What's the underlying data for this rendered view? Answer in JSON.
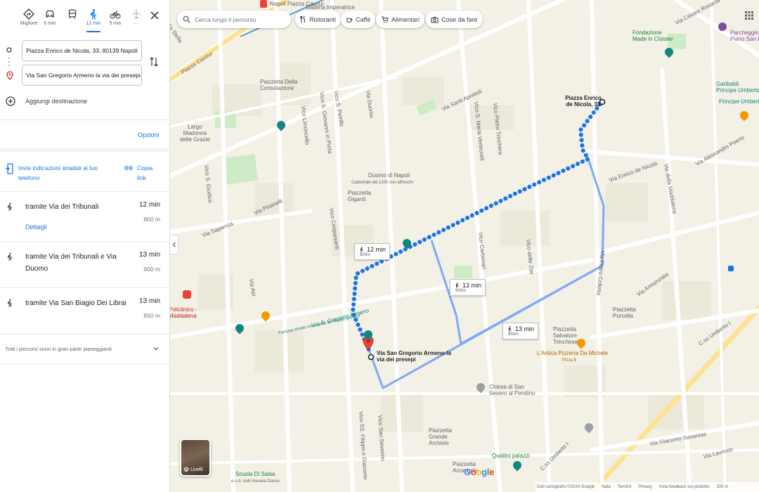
{
  "modes": [
    {
      "label": "Migliore",
      "icon": "best-route-icon"
    },
    {
      "label": "6 min",
      "icon": "car-icon"
    },
    {
      "label": "",
      "icon": "transit-icon"
    },
    {
      "label": "12 min",
      "icon": "walk-icon",
      "active": true
    },
    {
      "label": "5 min",
      "icon": "bike-icon"
    },
    {
      "label": "—",
      "icon": "flight-icon"
    }
  ],
  "origin": "Piazza Enrico de Nicola, 33, 80139 Napoli",
  "destination": "Via San Gregorio Armeno la via dei presepi",
  "add_destination": "Aggiungi destinazione",
  "options": "Opzioni",
  "send_to_phone": "Invia indicazioni stradali al tuo telefono",
  "copy_link": "Copia link",
  "routes": [
    {
      "name": "tramite Via dei Tribunali",
      "time": "12 min",
      "distance": "800 m",
      "details": "Dettagli"
    },
    {
      "name": "tramite Via dei Tribunali e Via Duomo",
      "time": "13 min",
      "distance": "900 m"
    },
    {
      "name": "tramite Via San Biagio Dei Librai",
      "time": "13 min",
      "distance": "850 m"
    }
  ],
  "flat_note": "Tutti i percorsi sono in gran parte pianeggianti",
  "search_placeholder": "Cerca lungo il percorso",
  "chips": [
    "Ristoranti",
    "Caffè",
    "Alimentari",
    "Cose da fare"
  ],
  "route_tags": [
    {
      "time": "12 min",
      "dist": "800m"
    },
    {
      "time": "13 min",
      "dist": "900m"
    },
    {
      "time": "13 min",
      "dist": "850m"
    }
  ],
  "start_label": "Piazza Enrico de Nicola, 33",
  "end_label": "Via San Gregorio Armeno la via dei presepi",
  "layers_label": "Livelli",
  "footer": [
    "Dati cartografici ©2024 Google",
    "Italia",
    "Termini",
    "Privacy",
    "Invia feedback sul prodotto",
    "100 m"
  ],
  "map_labels": {
    "napoli_cavour": "Napoli Piazza Cavour",
    "galleria": "Galleria Imperatrice",
    "via_stella": "Via Stella",
    "via_cesare_rosaroll": "Via Cesare Rosaroll",
    "fondazione": "Fondazione\nMade in Cloister",
    "parcheggio": "Parcheggio Quarto\nPiano San Francesco",
    "garibaldi": "Garibaldi\nPrincipe Umberto I",
    "principe_umberto": "Principe Umberto",
    "piazza_cavour": "Piazza Cavour",
    "consolazione": "Piazzetta Della\nConsolazione",
    "madonna": "Largo\nMadonna\ndelle Grazie",
    "via_santi_apostoli": "Via Santi Apostoli",
    "duomo": "Duomo di Napoli",
    "duomo_sub": "Cattedrale del 1200 con affreschi",
    "piazzetta_gigante": "Piazzetta\nGiganti",
    "via_duomo": "Via Duomo",
    "via_alessandro_poerio": "Via Alessandro Poerio",
    "via_enrico_de_nicola": "Via Enrico de Nicola",
    "piazza_enrico_de_nicola": "Piazza Enrico de Nicola",
    "via_della_maddalena": "Via della Maddalena",
    "vico_petrillo": "Vico S. Petrillo",
    "vico_giovanni_in_porta": "Vico S. Giovanni in Porta",
    "vico_limoncello": "Vico Limoncello",
    "vico_giudice": "Vico S. Giudice",
    "via_pisanelli": "Via Pisanelli",
    "via_sapienza": "Via Sapienza",
    "vico_cinquesanti": "Vico Cinquesanti",
    "via_atri": "Via Atri",
    "via_pietro_colletta": "Via Pietro Colletta",
    "via_annunziata": "Via Annunziata",
    "vico_carbonari": "Vico Carbonari",
    "vico_zite": "Vico delle Zite",
    "vico_maria_vertecoeli": "Vico S. Maria Vertecoeli",
    "vico_pietro_trinchera": "Vico Pietro Trinchera",
    "policlinico": "Policlinico -\nMaddalena",
    "via_s_gregorio": "Via S. Gregorio Armeno",
    "famosa": "Famosa strada nota come la \"via dei presepi\"",
    "piazzetta_trinchese": "Piazzetta\nSalvatore\nTrinchese",
    "pizza_michele": "L'Antica Pizzeria Da Michele",
    "pizza_michele_sub": "Pizza $",
    "piazzetta_porcella": "Piazzetta\nPorcella",
    "chiesa": "Chiesa di San\nSevero al Pendino",
    "archivio": "Piazzetta\nGrande\nArchivio",
    "quattro_palazzi": "Quattro palazzi",
    "piazzetta_arcangelo": "Piazzetta\nArcangelo",
    "scuola_salsa": "Scuola Di Salsa",
    "havana": "e.s.d. club Havana Dance",
    "c_so_umberto": "C.so Umberto I",
    "via_giacomo_savarese": "Via Giacomo Savarese",
    "vico_ss_filippo": "Vico SS. Filippo e Giacomo",
    "vico_san_severino": "Vico San Severino",
    "via_lavinaio": "Via Lavinaio",
    "piazza_cavour_street": "Piazza Cavour"
  },
  "colors": {
    "accent": "#1a73e8",
    "route_primary": "#1a73e8",
    "route_alt": "#7baaf7",
    "map_bg": "#f3f0e5",
    "main_road": "#fde293",
    "destination_pin": "#ea4335"
  }
}
